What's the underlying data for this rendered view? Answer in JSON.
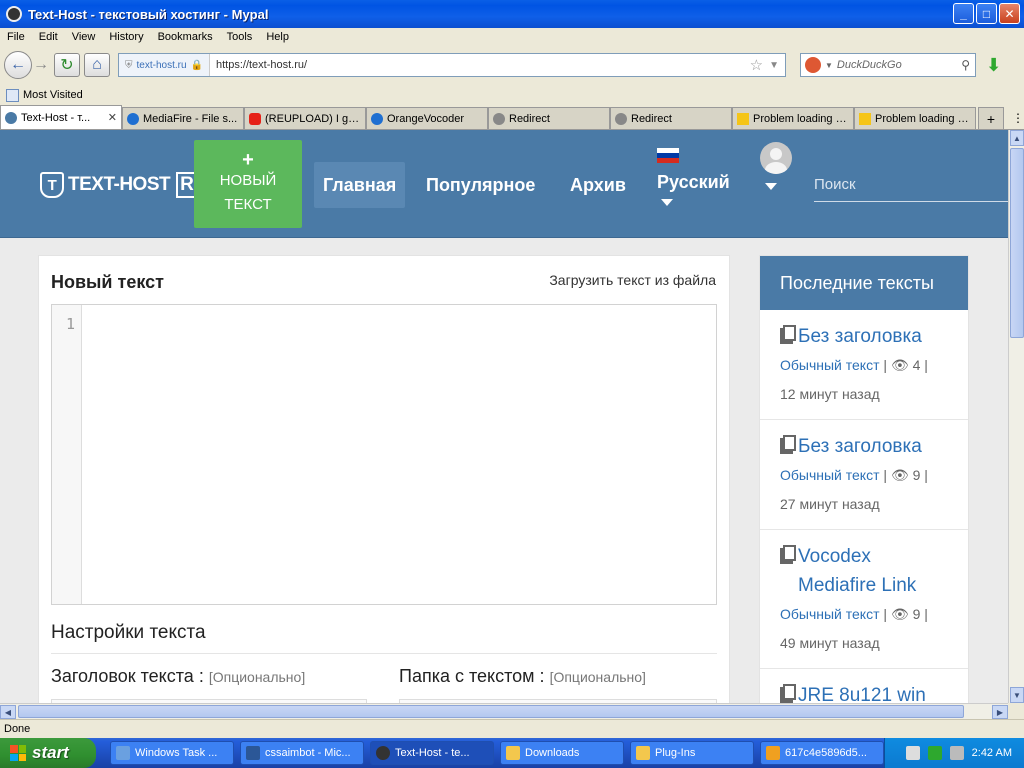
{
  "window": {
    "title": "Text-Host - текстовый хостинг - Mypal"
  },
  "menu": [
    "File",
    "Edit",
    "View",
    "History",
    "Bookmarks",
    "Tools",
    "Help"
  ],
  "nav": {
    "site_label": "text-host.ru",
    "url": "https://text-host.ru/",
    "search_placeholder": "DuckDuckGo"
  },
  "bookmarks": {
    "most_visited": "Most Visited"
  },
  "tabs": [
    {
      "label": "Text-Host - т...",
      "icon_color": "#4a7aa6",
      "active": true
    },
    {
      "label": "MediaFire - File s...",
      "icon_color": "#1f6fd1"
    },
    {
      "label": "(REUPLOAD) I go...",
      "icon_color": "#e62117"
    },
    {
      "label": "OrangeVocoder",
      "icon_color": "#1f6fd1"
    },
    {
      "label": "Redirect",
      "icon_color": "#888888"
    },
    {
      "label": "Redirect",
      "icon_color": "#888888"
    },
    {
      "label": "Problem loading p...",
      "icon_color": "#f5c518"
    },
    {
      "label": "Problem loading p...",
      "icon_color": "#f5c518"
    }
  ],
  "site": {
    "logo_text": "TEXT-HOST",
    "logo_suffix": "RU",
    "new_text_plus": "+",
    "new_text_line1": "НОВЫЙ",
    "new_text_line2": "ТЕКСТ",
    "nav_home": "Главная",
    "nav_popular": "Популярное",
    "nav_archive": "Архив",
    "language": "Русский",
    "search_placeholder": "Поиск"
  },
  "editor": {
    "title": "Новый текст",
    "upload_link": "Загрузить текст из файла",
    "line_number": "1",
    "settings_title": "Настройки текста",
    "title_label": "Заголовок текста :",
    "title_optional": "[Опционально]",
    "folder_label": "Папка с текстом :",
    "folder_optional": "[Опционально]"
  },
  "sidebar": {
    "heading": "Последние тексты",
    "posts": [
      {
        "title": "Без заголовка",
        "type": "Обычный текст",
        "views": "4",
        "time": "12 минут назад"
      },
      {
        "title": "Без заголовка",
        "type": "Обычный текст",
        "views": "9",
        "time": "27 минут назад"
      },
      {
        "title": "Vocodex Mediafire Link",
        "type": "Обычный текст",
        "views": "9",
        "time": "49 минут назад"
      }
    ],
    "partial_post": "JRE 8u121 win"
  },
  "status": {
    "text": "Done"
  },
  "taskbar": {
    "start": "start",
    "tasks": [
      {
        "label": "Windows Task ...",
        "icon_color": "#6aa0e0"
      },
      {
        "label": "cssaimbot - Mic...",
        "icon_color": "#2b5797"
      },
      {
        "label": "Text-Host - te...",
        "icon_color": "#333333",
        "active": true
      },
      {
        "label": "Downloads",
        "icon_color": "#f3c74d"
      },
      {
        "label": "Plug-Ins",
        "icon_color": "#f3c74d"
      },
      {
        "label": "617c4e5896d5...",
        "icon_color": "#f0a020"
      }
    ],
    "clock": "2:42 AM"
  }
}
